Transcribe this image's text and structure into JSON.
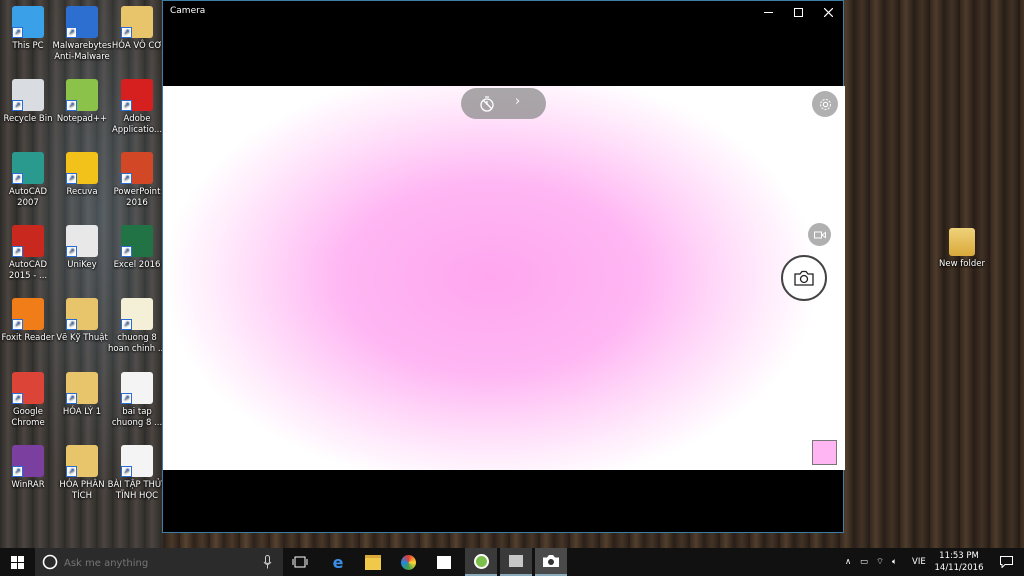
{
  "desktop": {
    "icons_left": [
      {
        "label": "This PC",
        "icon": "this-pc-icon",
        "color": "#3aa0e8"
      },
      {
        "label": "Malwarebytes Anti-Malware",
        "icon": "malwarebytes-icon",
        "color": "#2d6fd1"
      },
      {
        "label": "HÓA VÔ CƠ",
        "icon": "folder-icon",
        "color": "#e8c56a"
      },
      {
        "label": "Recycle Bin",
        "icon": "recycle-bin-icon",
        "color": "#d9dde2"
      },
      {
        "label": "Notepad++",
        "icon": "notepad-plus-plus-icon",
        "color": "#8bc34a"
      },
      {
        "label": "Adobe Applicatio...",
        "icon": "adobe-icon",
        "color": "#d62020"
      },
      {
        "label": "AutoCAD 2007",
        "icon": "autocad-2007-icon",
        "color": "#2a9a8f"
      },
      {
        "label": "Recuva",
        "icon": "recuva-icon",
        "color": "#f2c21a"
      },
      {
        "label": "PowerPoint 2016",
        "icon": "powerpoint-icon",
        "color": "#d24726"
      },
      {
        "label": "AutoCAD 2015 - ...",
        "icon": "autocad-2015-icon",
        "color": "#c8281e"
      },
      {
        "label": "UniKey",
        "icon": "unikey-icon",
        "color": "#e8e8e8"
      },
      {
        "label": "Excel 2016",
        "icon": "excel-icon",
        "color": "#217346"
      },
      {
        "label": "Foxit Reader",
        "icon": "foxit-reader-icon",
        "color": "#f07d18"
      },
      {
        "label": "Vẽ Kỹ Thuật",
        "icon": "folder-docs-icon",
        "color": "#e8c56a"
      },
      {
        "label": "chuong 8 hoan chinh ...",
        "icon": "pdf-document-icon",
        "color": "#f4f0d8"
      },
      {
        "label": "Google Chrome",
        "icon": "chrome-icon",
        "color": "#db4437"
      },
      {
        "label": "HÓA LÝ 1",
        "icon": "folder-icon",
        "color": "#e8c56a"
      },
      {
        "label": "bai tap chuong 8 ...",
        "icon": "pdf-document-icon",
        "color": "#f4f4f4"
      },
      {
        "label": "WinRAR",
        "icon": "winrar-icon",
        "color": "#7b3fa0"
      },
      {
        "label": "HÓA PHÂN TÍCH",
        "icon": "folder-icon",
        "color": "#e8c56a"
      },
      {
        "label": "BÀI TẬP THỦY TĨNH HỌC",
        "icon": "pdf-document-icon",
        "color": "#f4f4f4"
      }
    ],
    "icon_right": {
      "label": "New folder",
      "icon": "folder-icon",
      "color": "#e8c56a"
    }
  },
  "camera": {
    "title": "Camera",
    "timer_chevron": "›",
    "accent": "#ffa6ef"
  },
  "taskbar": {
    "search_placeholder": "Ask me anything",
    "language": "VIE",
    "time": "11:53 PM",
    "date": "14/11/2016"
  }
}
